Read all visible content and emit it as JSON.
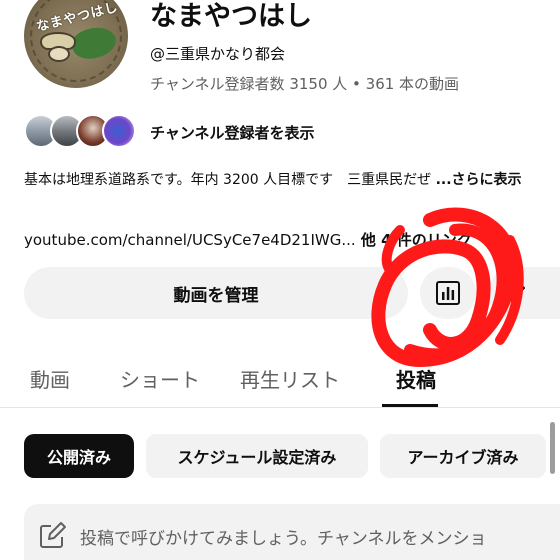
{
  "channel": {
    "name": "なまやつはし",
    "handle": "@三重県かなり都会",
    "stats": "チャンネル登録者数 3150 人 • 361 本の動画",
    "avatar_text": "なまやつはし"
  },
  "subscribers": {
    "link_label": "チャンネル登録者を表示"
  },
  "description": {
    "text": "基本は地理系道路系です。年内 3200 人目標です　三重県民だぜ ",
    "more_label": "...さらに表示"
  },
  "links": {
    "url": "youtube.com/channel/UCSyCe7e4D21IWG...",
    "extra": " 他 4 件のリンク"
  },
  "actions": {
    "manage_label": "動画を管理"
  },
  "tabs": [
    {
      "label": "動画"
    },
    {
      "label": "ショート"
    },
    {
      "label": "再生リスト"
    },
    {
      "label": "投稿"
    }
  ],
  "filters": [
    {
      "label": "公開済み"
    },
    {
      "label": "スケジュール設定済み"
    },
    {
      "label": "アーカイブ済み"
    }
  ],
  "post_input": {
    "placeholder": "投稿で呼びかけてみましょう。チャンネルをメンショ"
  },
  "colors": {
    "scribble": "#ff1a1a",
    "chip_active_bg": "#0f0f0f",
    "chip_bg": "#f2f2f2",
    "secondary_text": "#606060"
  },
  "icons": {
    "analytics": "bar-chart-icon",
    "edit": "pencil-icon",
    "post": "edit-square-icon"
  }
}
